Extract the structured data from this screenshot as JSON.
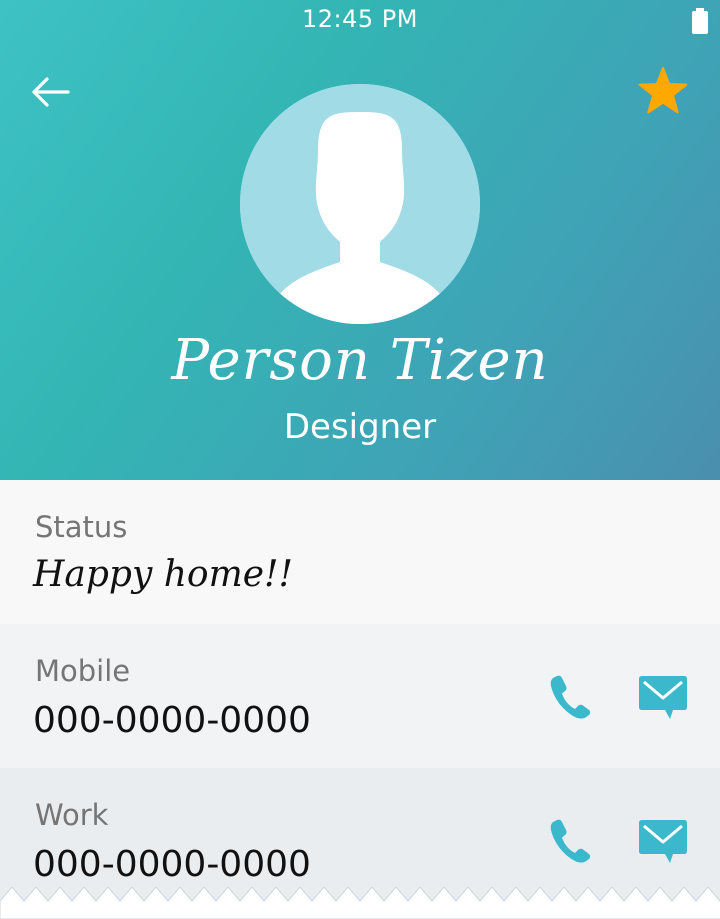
{
  "status_bar": {
    "time": "12:45 PM",
    "battery_icon": "battery-full-icon"
  },
  "header": {
    "back_icon": "arrow-left-icon",
    "favorite_icon": "star-icon",
    "favorite_color": "#ffa800",
    "avatar_icon": "person-silhouette-icon",
    "name": "Person Tizen",
    "title": "Designer"
  },
  "details": {
    "status": {
      "label": "Status",
      "value": "Happy home!!"
    },
    "mobile": {
      "label": "Mobile",
      "value": "000-0000-0000",
      "call_icon": "phone-icon",
      "message_icon": "message-icon"
    },
    "work": {
      "label": "Work",
      "value": "000-0000-0000",
      "call_icon": "phone-icon",
      "message_icon": "message-icon"
    }
  },
  "colors": {
    "accent": "#3bb8cc",
    "header_gradient_start": "#3fc2c4",
    "header_gradient_end": "#4a8fae"
  }
}
